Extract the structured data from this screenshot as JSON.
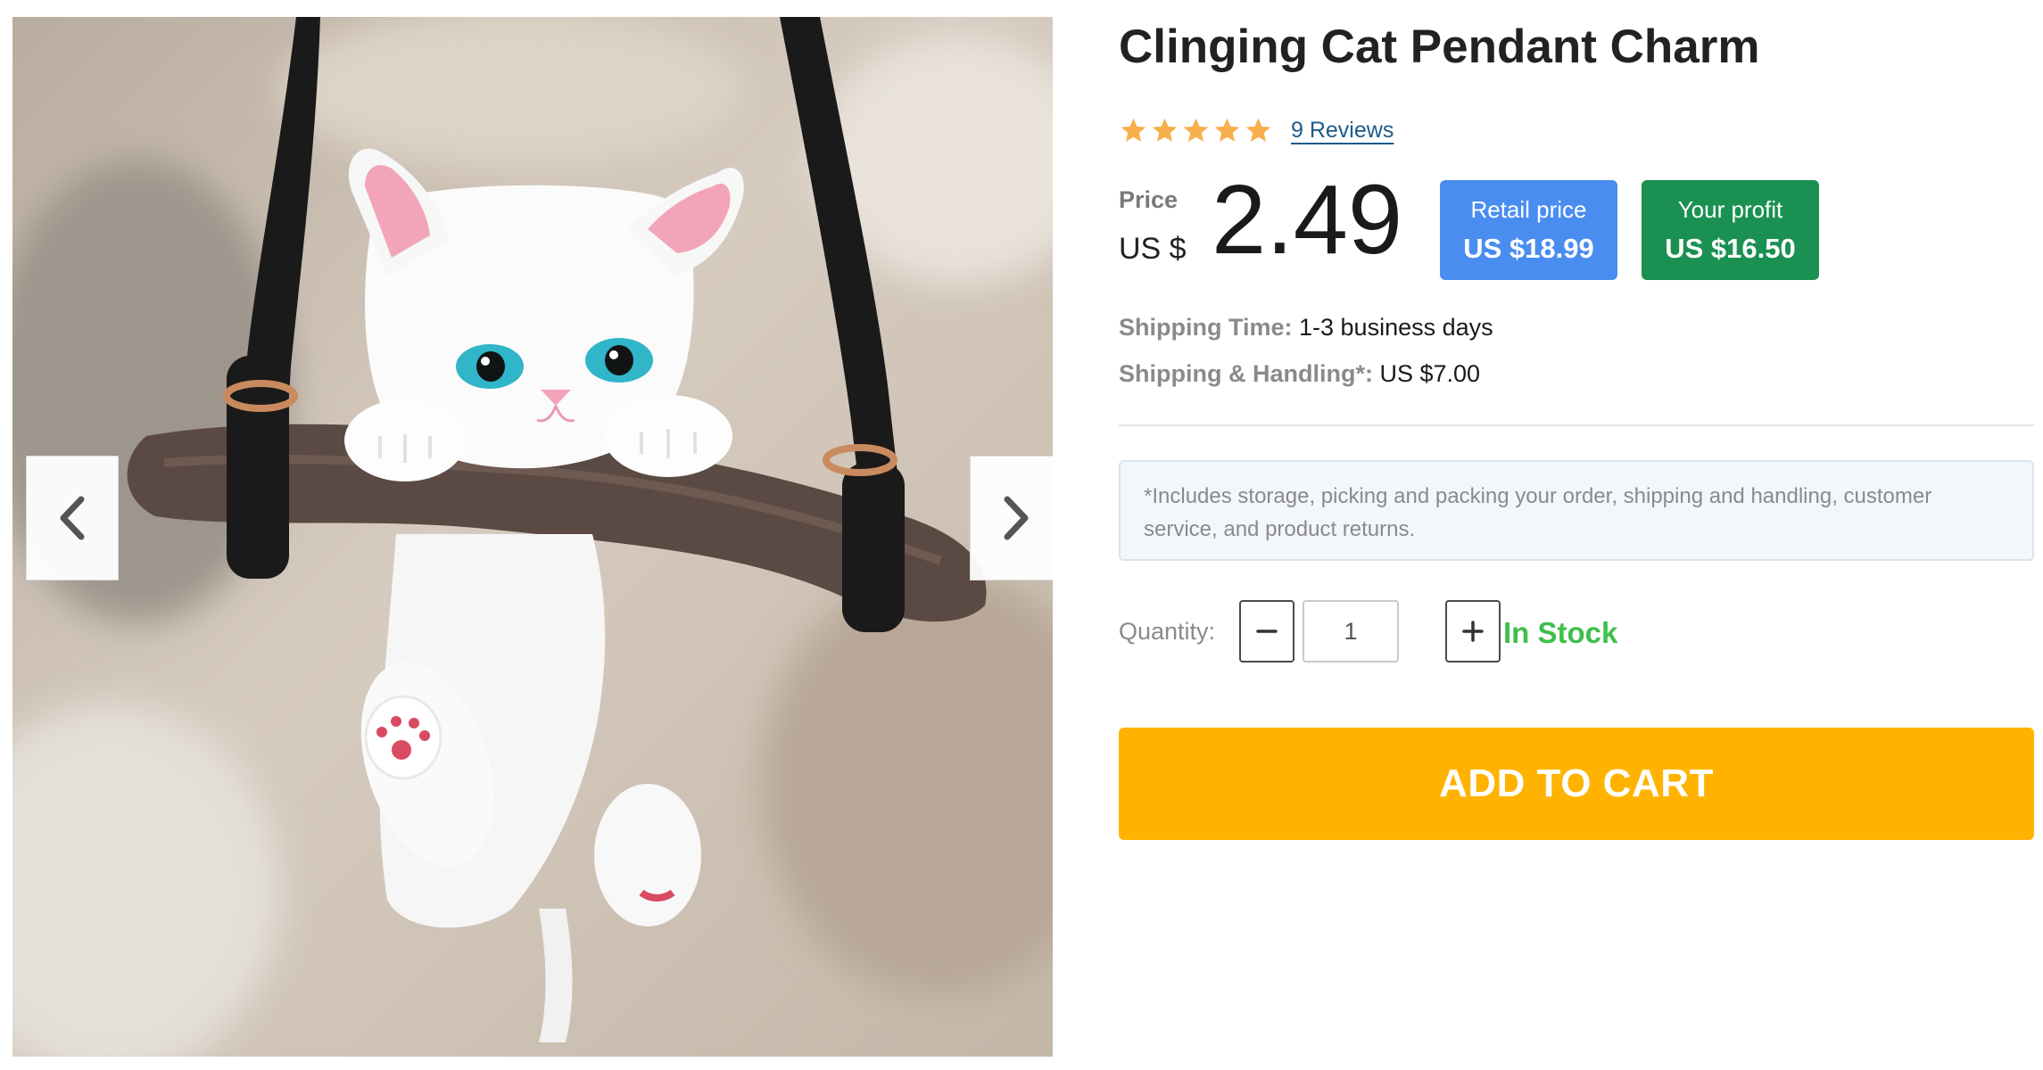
{
  "product": {
    "title": "Clinging Cat Pendant Charm",
    "rating": 5,
    "reviews_label": "9 Reviews"
  },
  "price": {
    "label": "Price",
    "currency": "US $",
    "value": "2.49"
  },
  "retail": {
    "label": "Retail price",
    "value": "US $18.99"
  },
  "profit": {
    "label": "Your profit",
    "value": "US $16.50"
  },
  "shipping": {
    "time_label": "Shipping Time:",
    "time_value": "1-3 business days",
    "handling_label": "Shipping & Handling*:",
    "handling_value": "US $7.00",
    "note": "*Includes storage, picking and packing your order, shipping and handling, customer service, and product returns."
  },
  "quantity": {
    "label": "Quantity:",
    "value": "1",
    "stock": "In Stock"
  },
  "actions": {
    "add_to_cart": "ADD TO CART"
  },
  "gallery": {
    "prev_icon": "chevron-left-icon",
    "next_icon": "chevron-right-icon"
  },
  "colors": {
    "retail_badge": "#4a8df0",
    "profit_badge": "#1a9152",
    "in_stock": "#3fbf4b",
    "add_to_cart": "#ffb300",
    "star": "#f8b04c",
    "link": "#1d5b8c"
  }
}
